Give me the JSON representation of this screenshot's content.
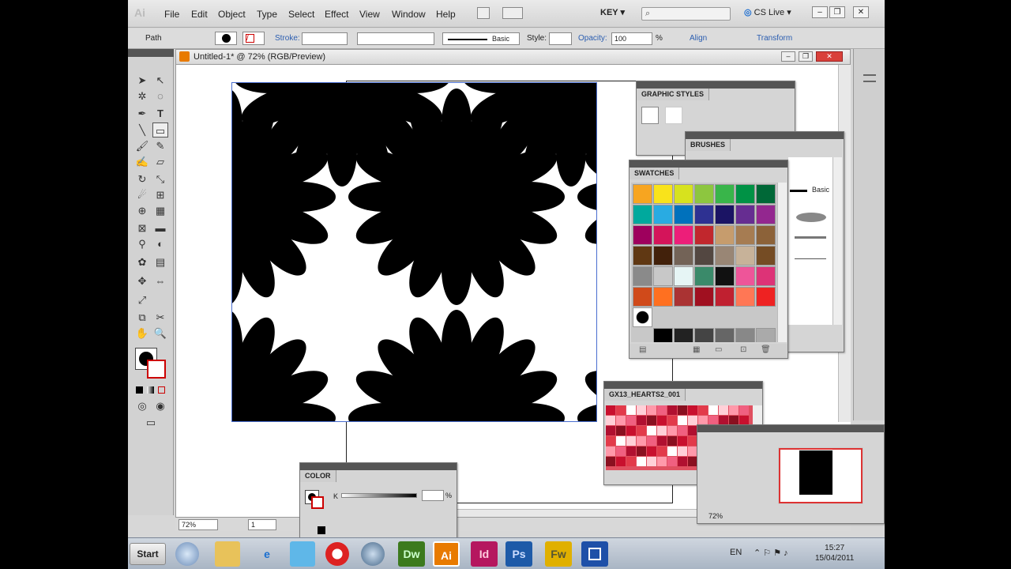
{
  "app": {
    "logo": "Ai"
  },
  "menu": [
    "File",
    "Edit",
    "Object",
    "Type",
    "Select",
    "Effect",
    "View",
    "Window",
    "Help"
  ],
  "workspace": {
    "label": "KEY ▾"
  },
  "cslive": {
    "label": "CS Live ▾"
  },
  "control": {
    "path_label": "Path",
    "stroke_label": "Stroke:",
    "brush_label": "Basic",
    "style_label": "Style:",
    "opacity_label": "Opacity:",
    "opacity_value": "100",
    "percent": "%",
    "align_label": "Align",
    "transform_label": "Transform"
  },
  "document": {
    "title": "Untitled-1* @ 72% (RGB/Preview)",
    "zoom": "72%",
    "page": "1"
  },
  "panels": {
    "graphic_styles": {
      "title": "GRAPHIC STYLES"
    },
    "brushes": {
      "title": "BRUSHES",
      "basic_label": "Basic"
    },
    "swatches": {
      "title": "SWATCHES",
      "colors": [
        "#f7a520",
        "#f9e31b",
        "#d7e21e",
        "#8dc63f",
        "#39b54a",
        "#009245",
        "#006837",
        "#00a99d",
        "#29abe2",
        "#0071bc",
        "#2e3192",
        "#1b1464",
        "#662d91",
        "#93278f",
        "#9e005d",
        "#d4145a",
        "#ed1e79",
        "#c1272d",
        "#c69c6d",
        "#a67c52",
        "#8c6239",
        "#603813",
        "#42210b",
        "#736357",
        "#534741",
        "#998675",
        "#c7b299",
        "#754c24"
      ]
    },
    "hearts": {
      "title": "GX13_HEARTS2_001"
    },
    "color": {
      "title": "COLOR",
      "channel": "K",
      "percent": "%"
    },
    "navigator": {
      "zoom": "72%"
    }
  },
  "taskbar": {
    "start": "Start",
    "apps": [
      {
        "label": "Dw",
        "color": "#3c7a1e"
      },
      {
        "label": "Ai",
        "color": "#e87a00"
      },
      {
        "label": "Id",
        "color": "#b5175f"
      },
      {
        "label": "Ps",
        "color": "#1d5aa8"
      },
      {
        "label": "Fw",
        "color": "#e0b000"
      }
    ],
    "lang": "EN",
    "time": "15:27",
    "date": "15/04/2011"
  }
}
